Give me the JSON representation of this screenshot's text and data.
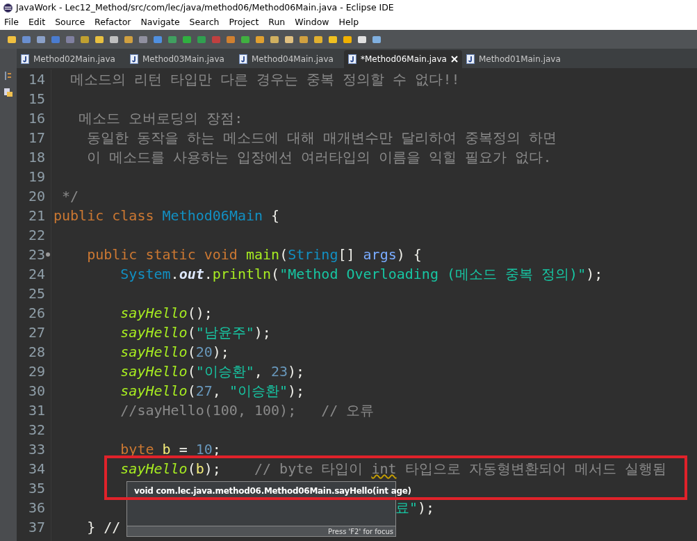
{
  "window": {
    "title": "JavaWork - Lec12_Method/src/com/lec/java/method06/Method06Main.java - Eclipse IDE"
  },
  "menu": [
    "File",
    "Edit",
    "Source",
    "Refactor",
    "Navigate",
    "Search",
    "Project",
    "Run",
    "Window",
    "Help"
  ],
  "tabs": [
    {
      "label": "Method02Main.java",
      "selected": false,
      "dirty": false
    },
    {
      "label": "Method03Main.java",
      "selected": false,
      "dirty": false
    },
    {
      "label": "Method04Main.java",
      "selected": false,
      "dirty": false
    },
    {
      "label": "*Method06Main.java",
      "selected": true,
      "dirty": true
    },
    {
      "label": "Method01Main.java",
      "selected": false,
      "dirty": false
    }
  ],
  "editor": {
    "lines": [
      {
        "number": "14",
        "marker": false,
        "tokens": [
          {
            "kind": "cmt",
            "text": "  메소드의 리턴 타입만 다른 경우는 중복 정의할 수 없다!!"
          }
        ]
      },
      {
        "number": "15",
        "marker": false
      },
      {
        "number": "16",
        "marker": false,
        "tokens": [
          {
            "kind": "cmt",
            "text": "   메소드 오버로딩의 장점:"
          }
        ]
      },
      {
        "number": "17",
        "marker": false,
        "tokens": [
          {
            "kind": "cmt",
            "text": "    동일한 동작을 하는 메소드에 대해 매개변수만 달리하여 중복정의 하면"
          }
        ]
      },
      {
        "number": "18",
        "marker": false,
        "tokens": [
          {
            "kind": "cmt",
            "text": "    이 메소드를 사용하는 입장에선 여러타입의 이름을 익힐 필요가 없다."
          }
        ]
      },
      {
        "number": "19",
        "marker": false
      },
      {
        "number": "20",
        "marker": false,
        "tokens": [
          {
            "kind": "cmt",
            "text": " */"
          }
        ]
      },
      {
        "number": "21",
        "marker": false,
        "tokens": [
          {
            "kind": "kw",
            "text": "public class "
          },
          {
            "kind": "cls",
            "text": "Method06Main"
          },
          {
            "kind": "plain",
            "text": " {"
          }
        ]
      },
      {
        "number": "22",
        "marker": false
      },
      {
        "number": "23",
        "marker": true,
        "tokens": [
          {
            "kind": "kw",
            "text": "    public static void "
          },
          {
            "kind": "method",
            "text": "main"
          },
          {
            "kind": "plain",
            "text": "("
          },
          {
            "kind": "cls",
            "text": "String"
          },
          {
            "kind": "plain",
            "text": "[] "
          },
          {
            "kind": "param",
            "text": "args"
          },
          {
            "kind": "plain",
            "text": ") {"
          }
        ]
      },
      {
        "number": "24",
        "marker": false,
        "tokens": [
          {
            "kind": "cls",
            "text": "        System"
          },
          {
            "kind": "plain",
            "text": "."
          },
          {
            "kind": "field",
            "text": "out"
          },
          {
            "kind": "plain",
            "text": "."
          },
          {
            "kind": "method",
            "text": "println"
          },
          {
            "kind": "plain",
            "text": "("
          },
          {
            "kind": "str",
            "text": "\"Method Overloading (메소드 중복 정의)\""
          },
          {
            "kind": "plain",
            "text": ");"
          }
        ]
      },
      {
        "number": "25",
        "marker": false
      },
      {
        "number": "26",
        "marker": false,
        "tokens": [
          {
            "kind": "smethod",
            "text": "        sayHello"
          },
          {
            "kind": "plain",
            "text": "();"
          }
        ]
      },
      {
        "number": "27",
        "marker": false,
        "tokens": [
          {
            "kind": "smethod",
            "text": "        sayHello"
          },
          {
            "kind": "plain",
            "text": "("
          },
          {
            "kind": "str",
            "text": "\"남윤주\""
          },
          {
            "kind": "plain",
            "text": ");"
          }
        ]
      },
      {
        "number": "28",
        "marker": false,
        "tokens": [
          {
            "kind": "smethod",
            "text": "        sayHello"
          },
          {
            "kind": "plain",
            "text": "("
          },
          {
            "kind": "num",
            "text": "20"
          },
          {
            "kind": "plain",
            "text": ");"
          }
        ]
      },
      {
        "number": "29",
        "marker": false,
        "tokens": [
          {
            "kind": "smethod",
            "text": "        sayHello"
          },
          {
            "kind": "plain",
            "text": "("
          },
          {
            "kind": "str",
            "text": "\"이승환\""
          },
          {
            "kind": "plain",
            "text": ", "
          },
          {
            "kind": "num",
            "text": "23"
          },
          {
            "kind": "plain",
            "text": ");"
          }
        ]
      },
      {
        "number": "30",
        "marker": false,
        "tokens": [
          {
            "kind": "smethod",
            "text": "        sayHello"
          },
          {
            "kind": "plain",
            "text": "("
          },
          {
            "kind": "num",
            "text": "27"
          },
          {
            "kind": "plain",
            "text": ", "
          },
          {
            "kind": "str",
            "text": "\"이승환\""
          },
          {
            "kind": "plain",
            "text": ");"
          }
        ]
      },
      {
        "number": "31",
        "marker": false,
        "tokens": [
          {
            "kind": "cmt",
            "text": "        //sayHello(100, 100);   // 오류"
          }
        ]
      },
      {
        "number": "32",
        "marker": false
      },
      {
        "number": "33",
        "marker": false,
        "tokens": [
          {
            "kind": "kw",
            "text": "        byte "
          },
          {
            "kind": "var",
            "text": "b"
          },
          {
            "kind": "plain",
            "text": " = "
          },
          {
            "kind": "num",
            "text": "10"
          },
          {
            "kind": "plain",
            "text": ";"
          }
        ]
      },
      {
        "number": "34",
        "marker": false,
        "tokens": [
          {
            "kind": "smethod",
            "text": "        sayHello"
          },
          {
            "kind": "plain",
            "text": "("
          },
          {
            "kind": "var",
            "text": "b"
          },
          {
            "kind": "plain",
            "text": ");    "
          },
          {
            "kind": "cmt",
            "text": "// byte 타입이 "
          },
          {
            "kind": "cmt_warn",
            "text": "int"
          },
          {
            "kind": "cmt",
            "text": " 타입으로 자동형변환되어 메서드 실행됨"
          }
        ]
      },
      {
        "number": "35",
        "marker": false
      },
      {
        "number": "36",
        "marker": false,
        "tokens": [
          {
            "kind": "popup_gap"
          },
          {
            "kind": "str",
            "text": "료\""
          },
          {
            "kind": "plain",
            "text": ");"
          }
        ]
      },
      {
        "number": "37",
        "marker": false,
        "tokens": [
          {
            "kind": "plain",
            "text": "    } //"
          }
        ]
      }
    ]
  },
  "tooltip": {
    "signature": "void com.lec.java.method06.Method06Main.sayHello(int age)",
    "hint": "Press 'F2' for focus"
  }
}
